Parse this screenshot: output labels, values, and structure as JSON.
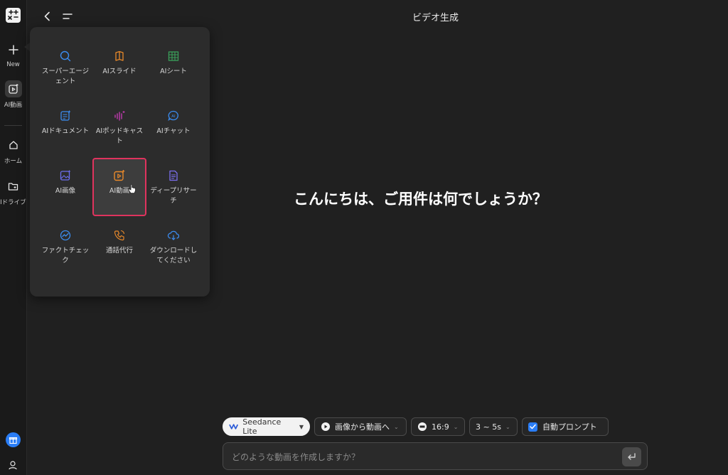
{
  "header": {
    "title": "ビデオ生成"
  },
  "sidebar": {
    "new_label": "New",
    "ai_video_label": "AI動画",
    "home_label": "ホーム",
    "drive_label": "AIドライブ"
  },
  "menu": {
    "items": [
      {
        "label": "スーパーエージェント",
        "icon": "search-bubble-icon",
        "color": "#3b8cf0"
      },
      {
        "label": "AIスライド",
        "icon": "slides-icon",
        "color": "#e8892a"
      },
      {
        "label": "AIシート",
        "icon": "sheet-icon",
        "color": "#3aa05a"
      },
      {
        "label": "AIドキュメント",
        "icon": "document-icon",
        "color": "#3b8cf0"
      },
      {
        "label": "AIポッドキャスト",
        "icon": "podcast-icon",
        "color": "#c03ab0"
      },
      {
        "label": "AIチャット",
        "icon": "chat-icon",
        "color": "#3b8cf0"
      },
      {
        "label": "AI画像",
        "icon": "image-icon",
        "color": "#6b6ff0"
      },
      {
        "label": "AI動画",
        "icon": "video-icon",
        "color": "#e8892a"
      },
      {
        "label": "ディープリサーチ",
        "icon": "research-icon",
        "color": "#7b6ff0"
      },
      {
        "label": "ファクトチェック",
        "icon": "factcheck-icon",
        "color": "#3b8cf0"
      },
      {
        "label": "通話代行",
        "icon": "phone-icon",
        "color": "#e8892a"
      },
      {
        "label": "ダウンロードしてください",
        "icon": "cloud-download-icon",
        "color": "#3b8cf0"
      }
    ]
  },
  "main": {
    "greeting": "こんにちは、ご用件は何でしょうか？"
  },
  "toolbar": {
    "model": "Seedance Lite",
    "mode": "画像から動画へ",
    "ratio": "16:9",
    "duration": "3 ~ 5s",
    "auto_prompt": "自動プロンプト"
  },
  "input": {
    "placeholder": "どのような動画を作成しますか？"
  }
}
